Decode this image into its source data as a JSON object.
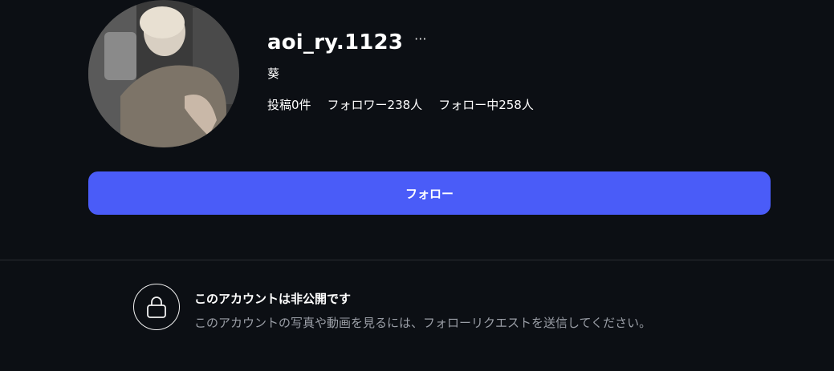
{
  "profile": {
    "username": "aoi_ry.1123",
    "more_label": "···",
    "display_name": "葵",
    "stats": {
      "posts": "投稿0件",
      "followers": "フォロワー238人",
      "following": "フォロー中258人"
    }
  },
  "actions": {
    "follow_label": "フォロー"
  },
  "private_notice": {
    "title": "このアカウントは非公開です",
    "description": "このアカウントの写真や動画を見るには、フォローリクエストを送信してください。"
  },
  "colors": {
    "background": "#0c0f14",
    "accent": "#4a5cf8",
    "muted_text": "#9a9ea6"
  },
  "icons": {
    "lock": "lock-icon",
    "more": "more-options-icon"
  }
}
